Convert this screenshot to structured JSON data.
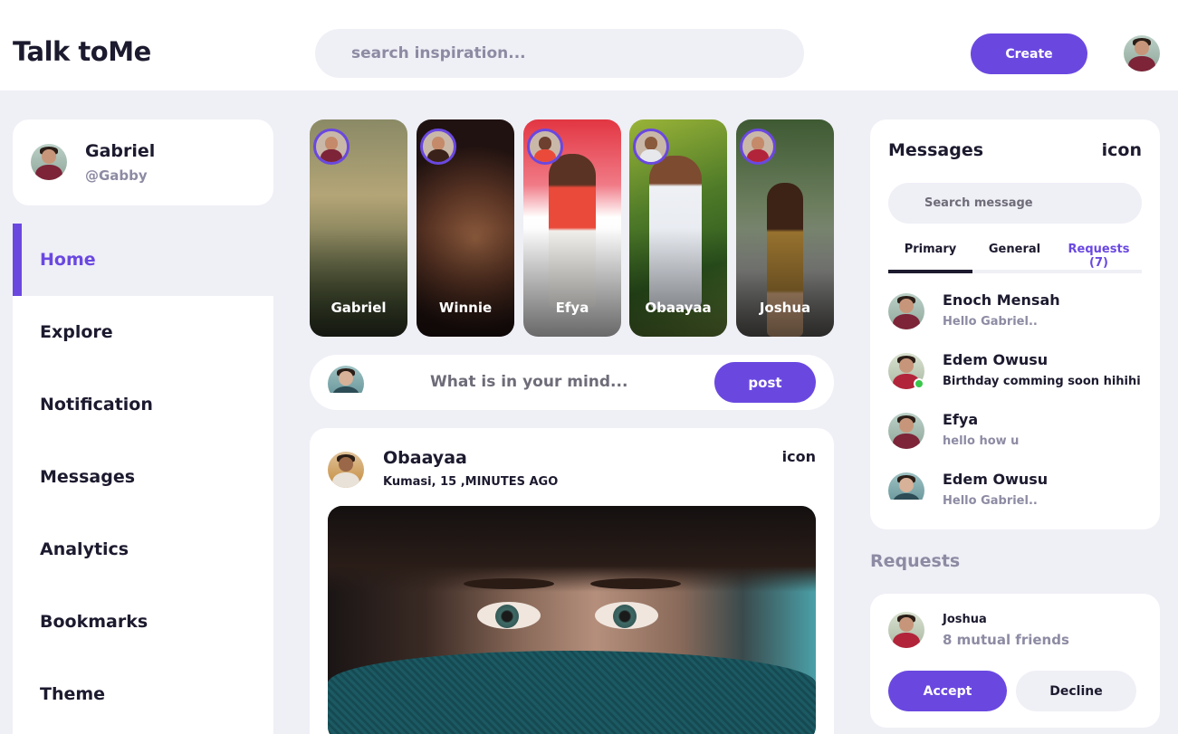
{
  "app": {
    "title": "Talk toMe"
  },
  "navbar": {
    "search_placeholder": "search inspiration...",
    "create_label": "Create",
    "avatar_icon": "user-avatar"
  },
  "profile": {
    "name": "Gabriel",
    "handle": "@Gabby"
  },
  "menu": {
    "items": [
      {
        "label": "Home",
        "active": true
      },
      {
        "label": "Explore"
      },
      {
        "label": "Notification"
      },
      {
        "label": "Messages"
      },
      {
        "label": "Analytics"
      },
      {
        "label": "Bookmarks"
      },
      {
        "label": "Theme"
      }
    ]
  },
  "stories": [
    {
      "name": "Gabriel"
    },
    {
      "name": "Winnie"
    },
    {
      "name": "Efya"
    },
    {
      "name": "Obaayaa"
    },
    {
      "name": "Joshua"
    }
  ],
  "composer": {
    "placeholder": "What is in your mind...",
    "post_label": "post"
  },
  "feed": {
    "user": "Obaayaa",
    "meta": "Kumasi, 15 ,MINUTES AGO",
    "icon_label": "icon"
  },
  "messages": {
    "title": "Messages",
    "icon_label": "icon",
    "search_placeholder": "Search message",
    "tabs": [
      "Primary",
      "General",
      "Requests (7)"
    ],
    "items": [
      {
        "name": "Enoch Mensah",
        "text": "Hello Gabriel..",
        "unread": false,
        "online": false
      },
      {
        "name": "Edem Owusu",
        "text": "Birthday comming soon hihihi",
        "unread": true,
        "online": true
      },
      {
        "name": "Efya",
        "text": "hello how u",
        "unread": false,
        "online": false
      },
      {
        "name": "Edem Owusu",
        "text": "Hello Gabriel..",
        "unread": false,
        "online": false
      }
    ]
  },
  "requests": {
    "heading": "Requests",
    "name": "Joshua",
    "mutual": "8 mutual friends",
    "accept_label": "Accept",
    "decline_label": "Decline"
  },
  "colors": {
    "accent": "#6a48e0",
    "background": "#efeff6",
    "text": "#1c1a2e",
    "muted": "#8d8ba3",
    "online": "#3ac64a"
  }
}
